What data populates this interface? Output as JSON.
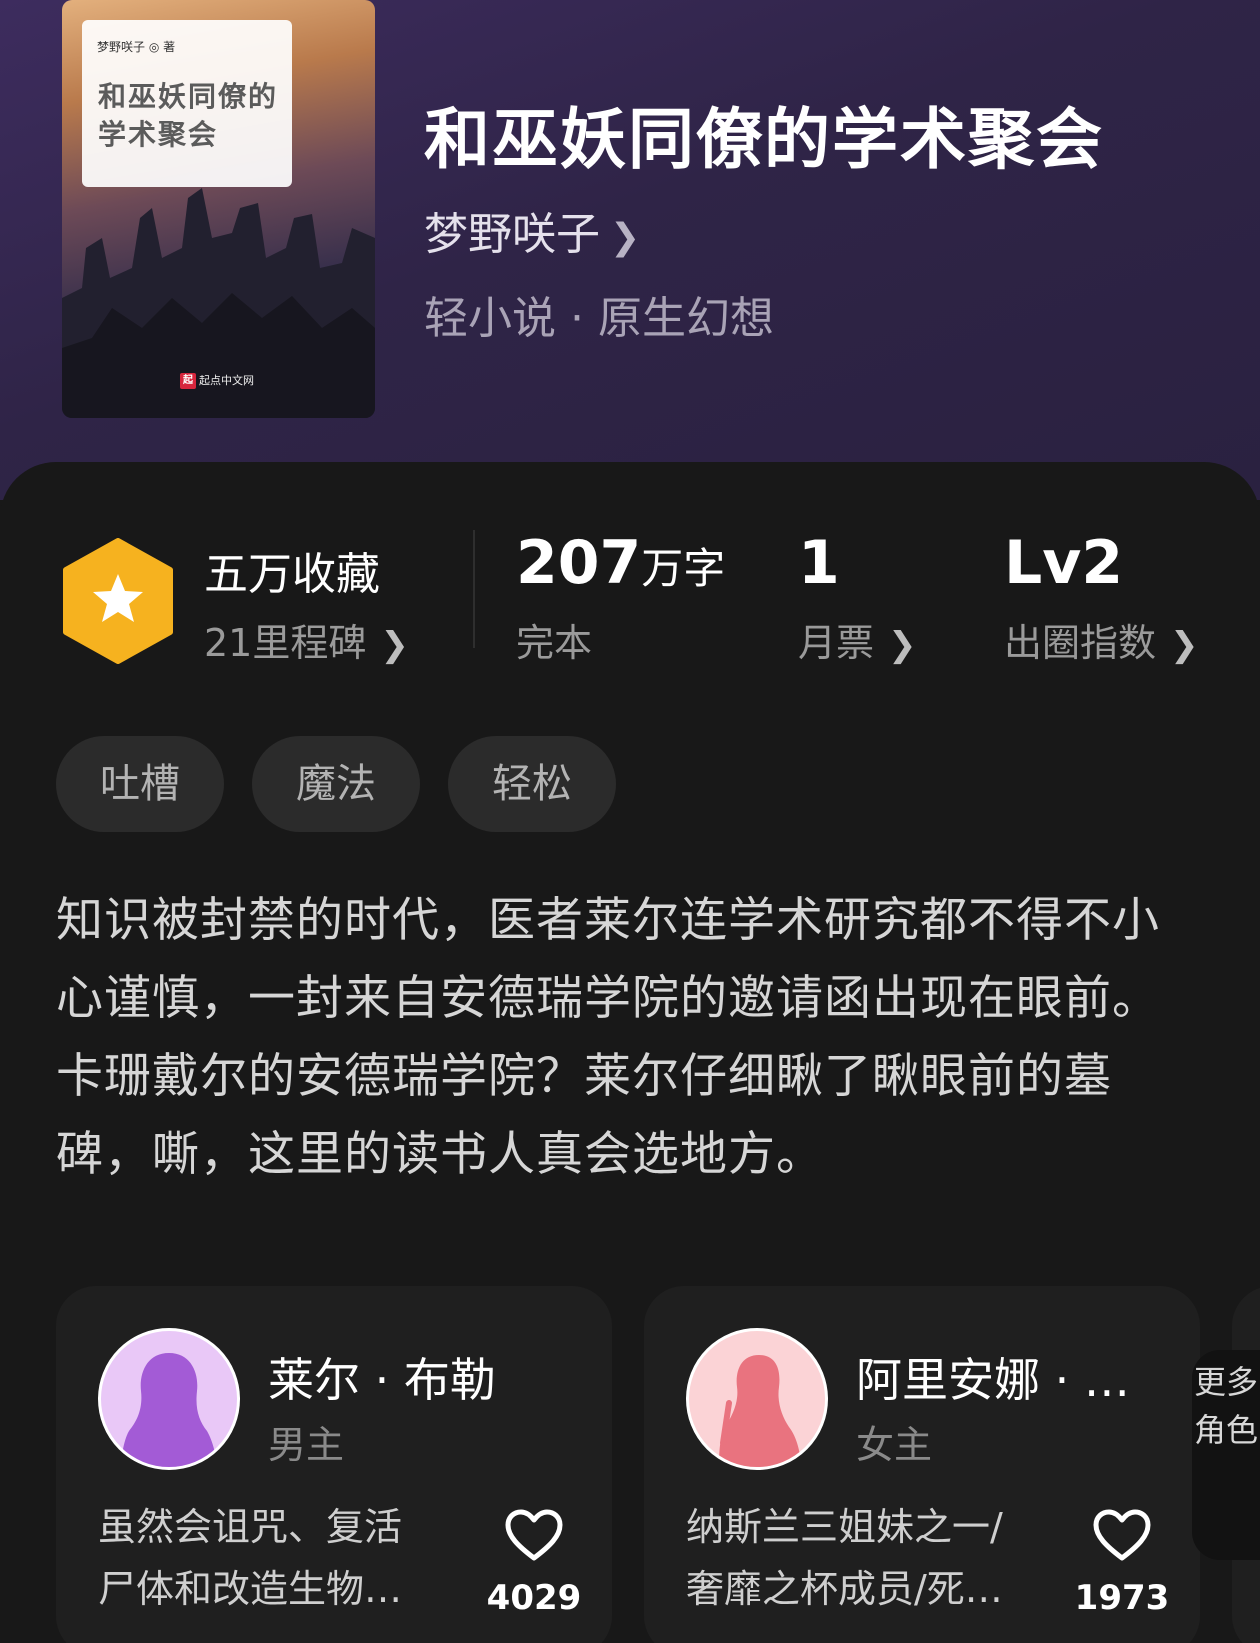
{
  "book": {
    "title": "和巫妖同僚的学术聚会",
    "author": "梦野咲子",
    "category": "轻小说 · 原生幻想",
    "cover": {
      "author_line": "梦野咲子 ◎ 著",
      "title_text": "和巫妖同僚的学术聚会",
      "publisher_mark": "起",
      "publisher": "起点中文网"
    }
  },
  "stats": {
    "milestone_title": "五万收藏",
    "milestone_sub": "21里程碑",
    "word_count": "207",
    "word_unit": "万字",
    "status": "完本",
    "monthly_tickets": "1",
    "monthly_label": "月票",
    "level": "Lv2",
    "level_label": "出圈指数"
  },
  "tags": [
    "吐槽",
    "魔法",
    "轻松"
  ],
  "intro": "知识被封禁的时代，医者莱尔连学术研究都不得不小心谨慎，一封来自安德瑞学院的邀请函出现在眼前。卡珊戴尔的安德瑞学院？莱尔仔细瞅了瞅眼前的墓碑，嘶，这里的读书人真会选地方。",
  "characters": [
    {
      "name": "莱尔 · 布勒",
      "role": "男主",
      "desc": "虽然会诅咒、复活尸体和改造生物…",
      "likes": "4029",
      "avatar_color": "#a35bd6"
    },
    {
      "name": "阿里安娜 · …",
      "role": "女主",
      "desc": "纳斯兰三姐妹之一/奢靡之杯成员/死…",
      "likes": "1973",
      "avatar_color": "#e9737f"
    }
  ],
  "more_roles": "更多角色",
  "icons": {
    "badge": "star-hexagon-icon",
    "chevron": "chevron-right-icon",
    "like": "heart-icon"
  },
  "colors": {
    "badge": "#f6b21f",
    "header_bg": "#2f2447"
  }
}
